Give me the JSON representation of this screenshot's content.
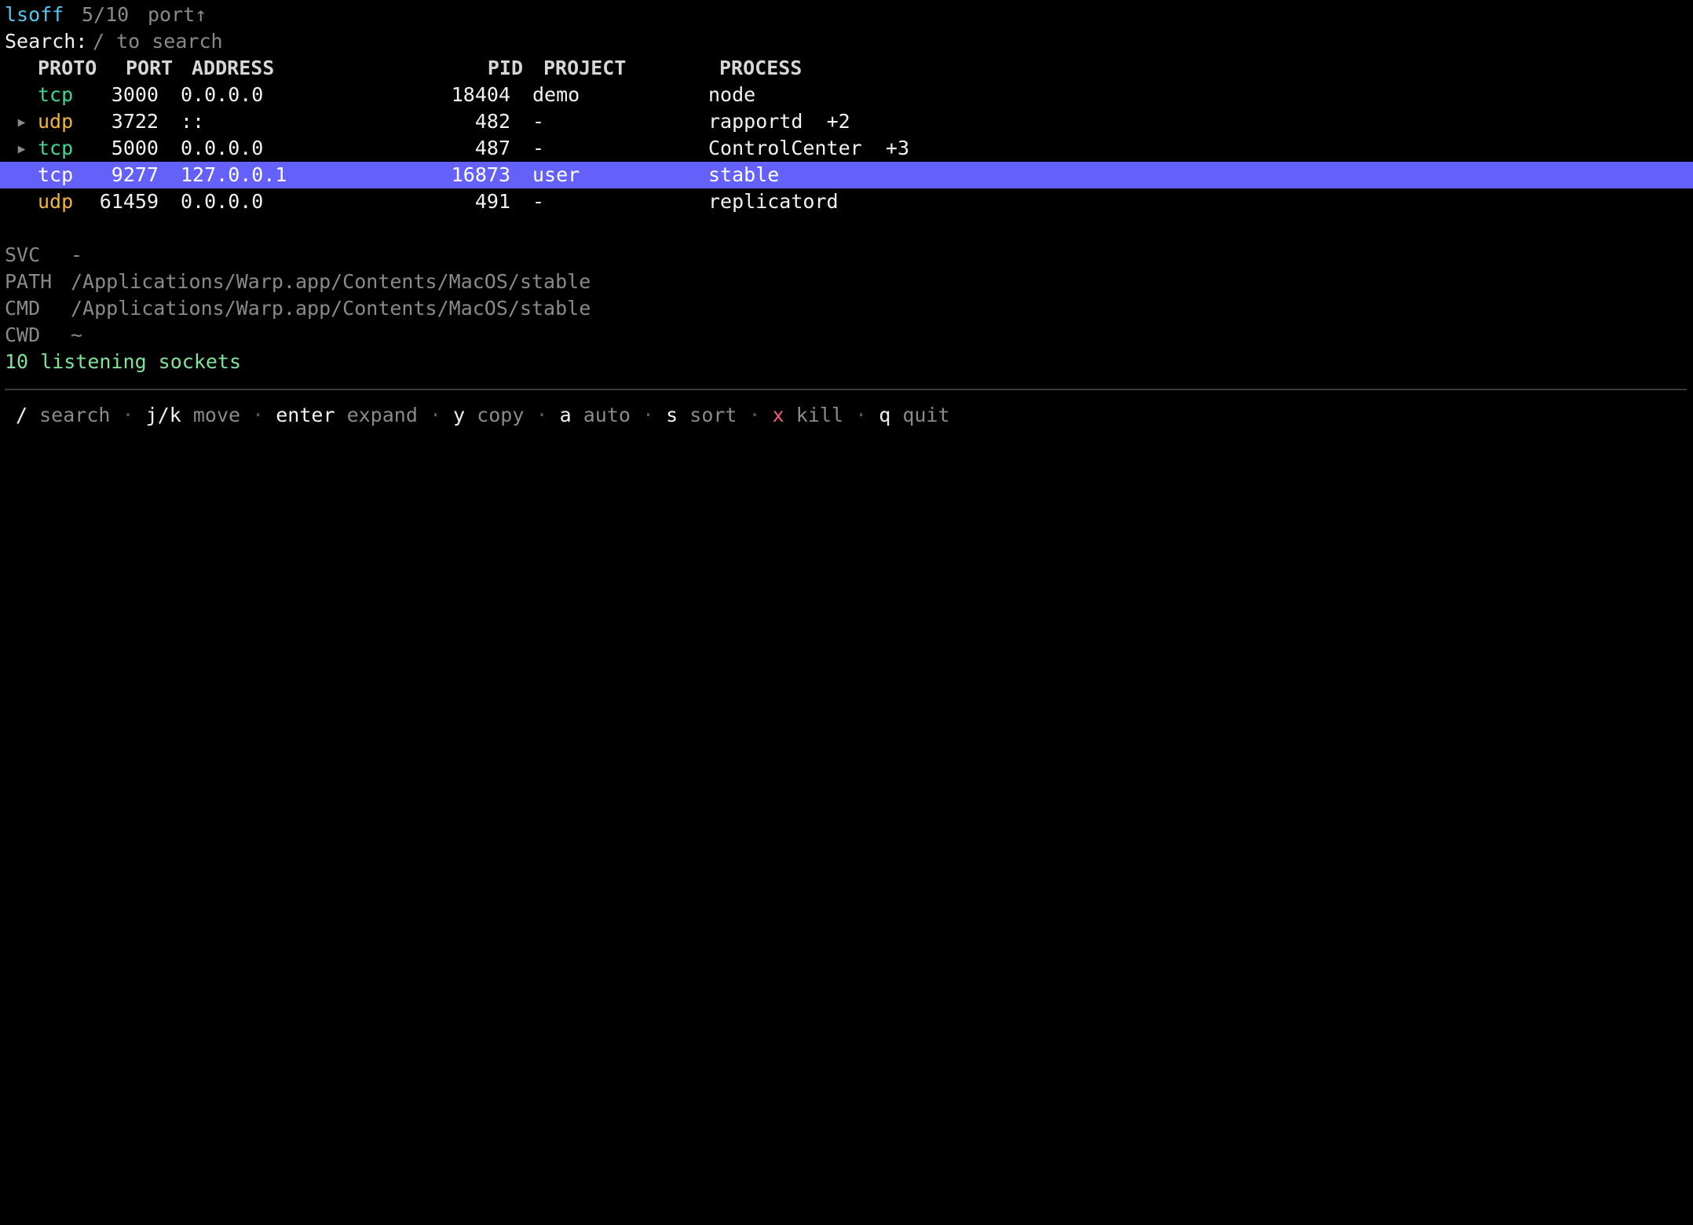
{
  "header": {
    "app": "lsoff",
    "count": "5/10",
    "sort": "port↑"
  },
  "search": {
    "label": "Search:",
    "placeholder": "/ to search"
  },
  "columns": {
    "proto": "PROTO",
    "port": "PORT",
    "address": "ADDRESS",
    "pid": "PID",
    "project": "PROJECT",
    "process": "PROCESS"
  },
  "rows": [
    {
      "marker": "",
      "proto": "tcp",
      "port": "3000",
      "address": "0.0.0.0",
      "pid": "18404",
      "project": "demo",
      "process": "node",
      "extra": "",
      "selected": false
    },
    {
      "marker": "▸",
      "proto": "udp",
      "port": "3722",
      "address": "::",
      "pid": "482",
      "project": "-",
      "process": "rapportd",
      "extra": "+2",
      "selected": false
    },
    {
      "marker": "▸",
      "proto": "tcp",
      "port": "5000",
      "address": "0.0.0.0",
      "pid": "487",
      "project": "-",
      "process": "ControlCenter",
      "extra": "+3",
      "selected": false
    },
    {
      "marker": "",
      "proto": "tcp",
      "port": "9277",
      "address": "127.0.0.1",
      "pid": "16873",
      "project": "user",
      "process": "stable",
      "extra": "",
      "selected": true
    },
    {
      "marker": "",
      "proto": "udp",
      "port": "61459",
      "address": "0.0.0.0",
      "pid": "491",
      "project": "-",
      "process": "replicatord",
      "extra": "",
      "selected": false
    }
  ],
  "details": [
    {
      "key": "SVC",
      "value": "-"
    },
    {
      "key": "PATH",
      "value": "/Applications/Warp.app/Contents/MacOS/stable"
    },
    {
      "key": "CMD",
      "value": "/Applications/Warp.app/Contents/MacOS/stable"
    },
    {
      "key": "CWD",
      "value": "~"
    }
  ],
  "status": "10 listening sockets",
  "footer": {
    "separator": "·",
    "keys": [
      {
        "key": "/",
        "label": "search"
      },
      {
        "key": "j/k",
        "label": "move"
      },
      {
        "key": "enter",
        "label": "expand"
      },
      {
        "key": "y",
        "label": "copy"
      },
      {
        "key": "a",
        "label": "auto"
      },
      {
        "key": "s",
        "label": "sort"
      },
      {
        "key": "x",
        "label": "kill"
      },
      {
        "key": "q",
        "label": "quit"
      }
    ]
  },
  "colors": {
    "background": "#000000",
    "app_title": "#56c7f2",
    "tcp": "#3fd69a",
    "udp": "#f3b43d",
    "status": "#7fe39a",
    "kill_key": "#ef5f7a",
    "selection": "#6461fb"
  }
}
